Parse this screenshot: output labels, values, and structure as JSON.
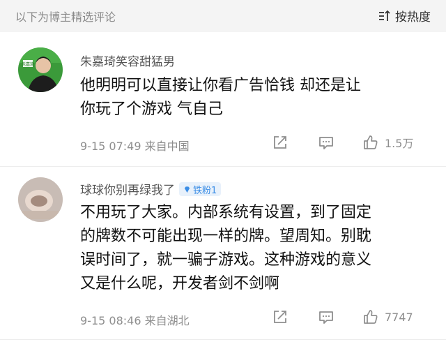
{
  "header": {
    "title": "以下为博主精选评论",
    "sort_label": "按热度",
    "sort_icon": "sort-icon"
  },
  "comments": [
    {
      "username": "朱嘉琦笑容甜猛男",
      "text_lines": [
        "他明明可以直接让你看广告恰钱 却还是让",
        "你玩了个游戏 气自己"
      ],
      "meta": "9-15 07:49 来自中国",
      "likes": "1.5万",
      "avatar_badge": "朱嘉琦"
    },
    {
      "username": "球球你别再绿我了",
      "badge": "铁粉1",
      "text_lines": [
        "不用玩了大家。内部系统有设置，到了固定",
        "的牌数不可能出现一样的牌。望周知。别耽",
        "误时间了，就一骗子游戏。这种游戏的意义",
        "又是什么呢，开发者剑不剑啊"
      ],
      "meta": "9-15 08:46 来自湖北",
      "likes": "7747"
    }
  ],
  "icons": {
    "share": "share-icon",
    "comment": "comment-icon",
    "like": "thumb-up-icon"
  },
  "colors": {
    "badge_blue": "#3c8ee6",
    "avatar_green": "#3b9a3a"
  }
}
